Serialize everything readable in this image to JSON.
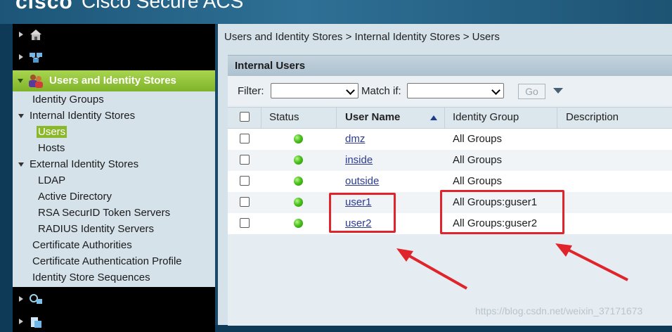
{
  "banner": {
    "logo": "cisco",
    "title": "Cisco Secure ACS"
  },
  "nav": {
    "bars_top": [
      {
        "icon": "home-icon"
      },
      {
        "icon": "network-resources-icon"
      }
    ],
    "active_section": {
      "label": "Users and Identity Stores",
      "icon": "users-icon"
    },
    "tree": {
      "identity_groups": "Identity Groups",
      "internal_identity_stores": "Internal Identity Stores",
      "users": "Users",
      "hosts": "Hosts",
      "external_identity_stores": "External Identity Stores",
      "ldap": "LDAP",
      "active_directory": "Active Directory",
      "rsa": "RSA SecurID Token Servers",
      "radius": "RADIUS Identity Servers",
      "cert_authorities": "Certificate Authorities",
      "cert_auth_profile": "Certificate Authentication Profile",
      "id_store_sequences": "Identity Store Sequences"
    },
    "bars_bottom": [
      {
        "icon": "policy-elements-icon"
      },
      {
        "icon": "access-policies-icon"
      }
    ]
  },
  "breadcrumb": "Users and Identity Stores > Internal Identity Stores > Users",
  "panel": {
    "title": "Internal Users",
    "filter_label": "Filter:",
    "filter_value": "",
    "match_label": "Match if:",
    "match_value": "",
    "go_label": "Go"
  },
  "table": {
    "columns": [
      "Status",
      "User Name",
      "Identity Group",
      "Description"
    ],
    "sorted_column": "User Name",
    "sort_direction": "ascending",
    "rows": [
      {
        "status": "enabled",
        "name": "dmz",
        "group": "All Groups",
        "description": ""
      },
      {
        "status": "enabled",
        "name": "inside",
        "group": "All Groups",
        "description": ""
      },
      {
        "status": "enabled",
        "name": "outside",
        "group": "All Groups",
        "description": ""
      },
      {
        "status": "enabled",
        "name": "user1",
        "group": "All Groups:guser1",
        "description": ""
      },
      {
        "status": "enabled",
        "name": "user2",
        "group": "All Groups:guser2",
        "description": ""
      }
    ]
  },
  "colors": {
    "active_green": "#8ab82a",
    "status_green": "#4cc21c",
    "annotation_red": "#e0242b",
    "link_blue": "#2d3c8f"
  },
  "watermark": "https://blog.csdn.net/weixin_37171673"
}
